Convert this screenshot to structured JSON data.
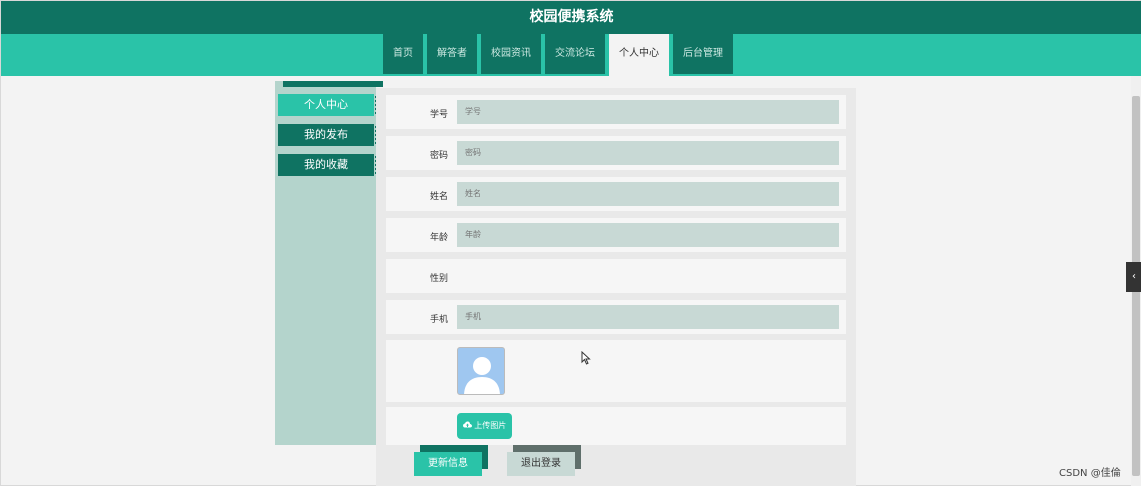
{
  "app": {
    "title": "校园便携系统"
  },
  "nav": {
    "tabs": [
      {
        "label": "首页"
      },
      {
        "label": "解答者"
      },
      {
        "label": "校园资讯"
      },
      {
        "label": "交流论坛"
      },
      {
        "label": "个人中心",
        "active": true
      },
      {
        "label": "后台管理"
      }
    ]
  },
  "sidebar": {
    "items": [
      {
        "label": "个人中心",
        "active": true
      },
      {
        "label": "我的发布"
      },
      {
        "label": "我的收藏"
      }
    ]
  },
  "form": {
    "student_id": {
      "label": "学号",
      "placeholder": "学号"
    },
    "password": {
      "label": "密码",
      "placeholder": "密码"
    },
    "name": {
      "label": "姓名",
      "placeholder": "姓名"
    },
    "age": {
      "label": "年龄",
      "placeholder": "年龄"
    },
    "gender": {
      "label": "性别"
    },
    "phone": {
      "label": "手机",
      "placeholder": "手机"
    },
    "upload_label": "上传图片",
    "update_label": "更新信息",
    "logout_label": "退出登录"
  },
  "icons": {
    "upload": "cloud-upload-icon",
    "avatar": "default-avatar-icon",
    "collapse": "chevron-left-icon"
  },
  "colors": {
    "header": "#0f7362",
    "nav": "#2ac3a8",
    "accent": "#2ac3a8",
    "input": "#c8d9d5"
  },
  "watermark": "CSDN @佳倫"
}
